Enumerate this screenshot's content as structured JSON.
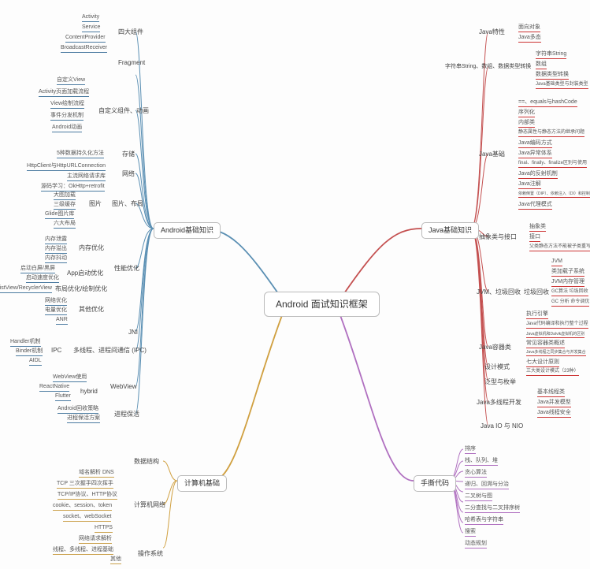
{
  "root": "Android 面试知识框架",
  "branches": {
    "android": {
      "title": "Android基础知识",
      "groups": {
        "four_components": {
          "label": "四大组件",
          "items": [
            "Activity",
            "Service",
            "ContentProvider",
            "BroadcastReceiver"
          ]
        },
        "fragment": {
          "label": "Fragment"
        },
        "custom_view": {
          "label": "自定义组件、动画",
          "items": [
            "自定义View",
            "Activity页面加载流程",
            "View绘制流程",
            "事件分发机制",
            "Android动画"
          ]
        },
        "storage": {
          "label": "存储",
          "items": [
            "5种数据持久化方法"
          ]
        },
        "network": {
          "label": "网络",
          "items": [
            "HttpClient与HttpURLConnection",
            "主流网络请求库",
            "源码学习：OkHttp+retrofit"
          ]
        },
        "image": {
          "label": "图片、布局",
          "sub": "图片",
          "items": [
            "大图加载",
            "三级缓存",
            "Glide图片库",
            "六大布局"
          ]
        },
        "performance": {
          "label": "性能优化",
          "subs": {
            "memory": {
              "label": "内存优化",
              "items": [
                "内存泄露",
                "内存溢出",
                "内存抖动"
              ]
            },
            "app_start": {
              "label": "App启动优化",
              "items": [
                "启动白屏/黑屏",
                "启动速度优化"
              ]
            },
            "layout": {
              "label": "布局优化/绘制优化",
              "items": [
                "ListView/RecyclerView"
              ]
            },
            "other": {
              "label": "其他优化",
              "items": [
                "网络优化",
                "电量优化",
                "ANR"
              ]
            }
          }
        },
        "jni": {
          "label": "JNI"
        },
        "ipc": {
          "label": "多线程、进程间通信 (IPC)",
          "sub": "IPC",
          "items": [
            "Handler机制",
            "Binder机制",
            "AIDL"
          ]
        },
        "webview": {
          "label": "WebView",
          "items": [
            "WebView使用",
            "ReactNative",
            "Flutter"
          ],
          "hybrid": "hybrid"
        },
        "process_keep": {
          "label": "进程保活",
          "items": [
            "Android回收策略",
            "进程保活方案"
          ]
        }
      }
    },
    "java": {
      "title": "Java基础知识",
      "groups": {
        "features": {
          "label": "Java特性",
          "items": [
            "面向对象",
            "Java多态"
          ]
        },
        "string_types": {
          "label": "字符串String、数组、数据类型转换",
          "items": [
            "字符串String",
            "数组",
            "数据类型转换",
            "Java基础类型与封装类型"
          ]
        },
        "basics": {
          "label": "Java基础",
          "items": [
            "==、equals与hashCode",
            "序列化",
            "内部类",
            "静态属性与静态方法的继承问题",
            "Java编码方式",
            "Java异常体系",
            "final、finally、finalize区别与使用",
            "Java的反射机制",
            "Java注解",
            "依赖倒置（DIP）、依赖注入（DI）和控制反转（IOC）",
            "Java代理模式"
          ]
        },
        "abstract_interface": {
          "label": "抽象类与接口",
          "items": [
            "抽象类",
            "接口",
            "父类静态方法不能被子类重写"
          ]
        },
        "jvm": {
          "label": "JVM、垃圾回收",
          "sub": "垃圾回收",
          "items": [
            "JVM",
            "类加载子系统",
            "JVM内存管理",
            "GC算法 垃圾回收",
            "GC 分析 命令调优",
            "执行引擎",
            "Java代码编译和执行整个过程",
            "Java虚拟机和Dalvik虚拟机的区别"
          ]
        },
        "container": {
          "label": "Java容器类",
          "items": [
            "常见容器类概述",
            "Java多线程之同步集合与并发集合"
          ]
        },
        "design_pattern": {
          "label": "设计模式",
          "items": [
            "七大设计原则",
            "三大类设计模式（23种）"
          ]
        },
        "generic": {
          "label": "泛型与枚举"
        },
        "multithread": {
          "label": "Java多线程开发",
          "items": [
            "基本线程类",
            "Java并发模型",
            "Java线程安全"
          ]
        },
        "io": {
          "label": "Java IO 与 NIO"
        }
      }
    },
    "cs": {
      "title": "计算机基础",
      "groups": {
        "data_structure": {
          "label": "数据结构"
        },
        "network": {
          "label": "计算机网络",
          "items": [
            "域名解析 DNS",
            "TCP 三次握手四次挥手",
            "TCP/IP协议、HTTP协议",
            "cookie、session、token",
            "socket、webSocket",
            "HTTPS",
            "网络请求解析"
          ]
        },
        "os": {
          "label": "操作系统",
          "items": [
            "线程、多线程、进程基础",
            "其他"
          ]
        }
      }
    },
    "handwrite": {
      "title": "手撕代码",
      "items": [
        "排序",
        "栈、队列、堆",
        "贪心算法",
        "递归、回溯与分治",
        "二叉树与图",
        "二分查找与二叉排序树",
        "哈希表与字符串",
        "搜索",
        "动态规划"
      ]
    }
  }
}
